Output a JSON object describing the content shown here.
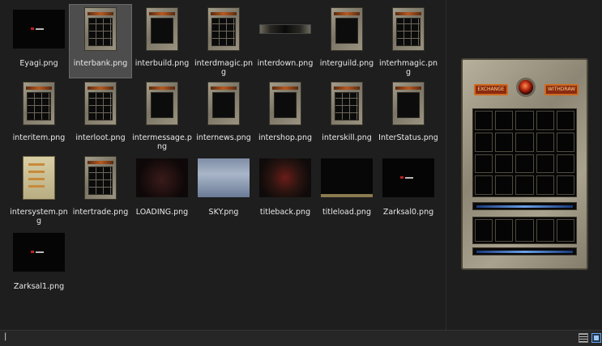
{
  "files": [
    {
      "name": "Eyagi.png",
      "type": "logo"
    },
    {
      "name": "interbank.png",
      "type": "grid",
      "selected": true
    },
    {
      "name": "interbuild.png",
      "type": "panel"
    },
    {
      "name": "interdmagic.png",
      "type": "grid"
    },
    {
      "name": "interdown.png",
      "type": "down"
    },
    {
      "name": "interguild.png",
      "type": "panel"
    },
    {
      "name": "interhmagic.png",
      "type": "grid"
    },
    {
      "name": "interitem.png",
      "type": "grid"
    },
    {
      "name": "interloot.png",
      "type": "grid"
    },
    {
      "name": "intermessage.png",
      "type": "panel"
    },
    {
      "name": "internews.png",
      "type": "panel"
    },
    {
      "name": "intershop.png",
      "type": "panel"
    },
    {
      "name": "interskill.png",
      "type": "grid"
    },
    {
      "name": "InterStatus.png",
      "type": "panel"
    },
    {
      "name": "intersystem.png",
      "type": "system"
    },
    {
      "name": "intertrade.png",
      "type": "grid"
    },
    {
      "name": "LOADING.png",
      "type": "loading"
    },
    {
      "name": "SKY.png",
      "type": "sky"
    },
    {
      "name": "titleback.png",
      "type": "titleback"
    },
    {
      "name": "titleload.png",
      "type": "titleload"
    },
    {
      "name": "Zarksal0.png",
      "type": "dark"
    },
    {
      "name": "Zarksal1.png",
      "type": "dark"
    }
  ],
  "preview": {
    "left_button": "EXCHANGE",
    "right_button": "WITHDRAW"
  },
  "status": {
    "text": "|"
  },
  "colors": {
    "background": "#1e1e1e",
    "selected": "#4d4d4d",
    "accent": "#6aa0e8"
  }
}
